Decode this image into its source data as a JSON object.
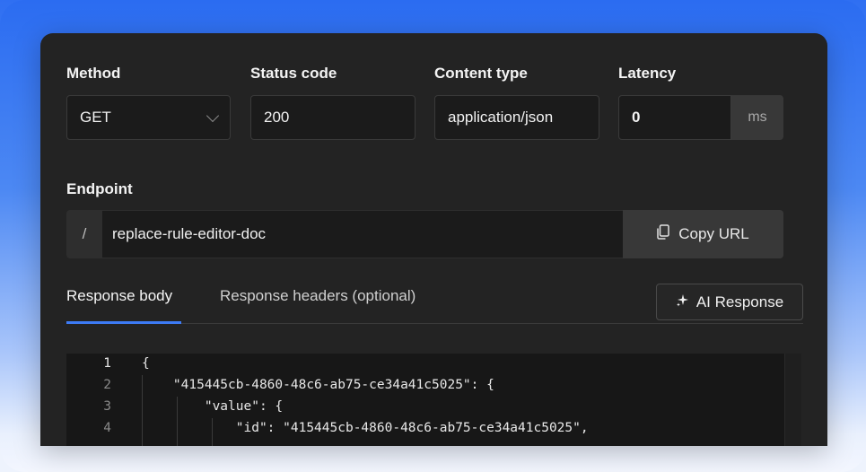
{
  "form": {
    "method_label": "Method",
    "method_value": "GET",
    "status_label": "Status code",
    "status_value": "200",
    "content_type_label": "Content type",
    "content_type_value": "application/json",
    "latency_label": "Latency",
    "latency_value": "0",
    "latency_unit": "ms"
  },
  "endpoint": {
    "label": "Endpoint",
    "prefix": "/",
    "value": "replace-rule-editor-doc",
    "copy_label": "Copy URL"
  },
  "tabs": [
    {
      "label": "Response body",
      "active": true
    },
    {
      "label": "Response headers (optional)",
      "active": false
    }
  ],
  "ai_button_label": "AI Response",
  "editor": {
    "lines": [
      {
        "num": "1",
        "text": "{"
      },
      {
        "num": "2",
        "text": "    \"415445cb-4860-48c6-ab75-ce34a41c5025\": {"
      },
      {
        "num": "3",
        "text": "        \"value\": {"
      },
      {
        "num": "4",
        "text": "            \"id\": \"415445cb-4860-48c6-ab75-ce34a41c5025\","
      }
    ]
  },
  "colors": {
    "accent": "#3d7bf5",
    "panel_bg": "#232323",
    "background_gradient_top": "#2b6cf1"
  },
  "icons": {
    "method_dropdown": "chevron-down-icon",
    "copy": "copy-icon",
    "ai": "sparkle-icon"
  }
}
